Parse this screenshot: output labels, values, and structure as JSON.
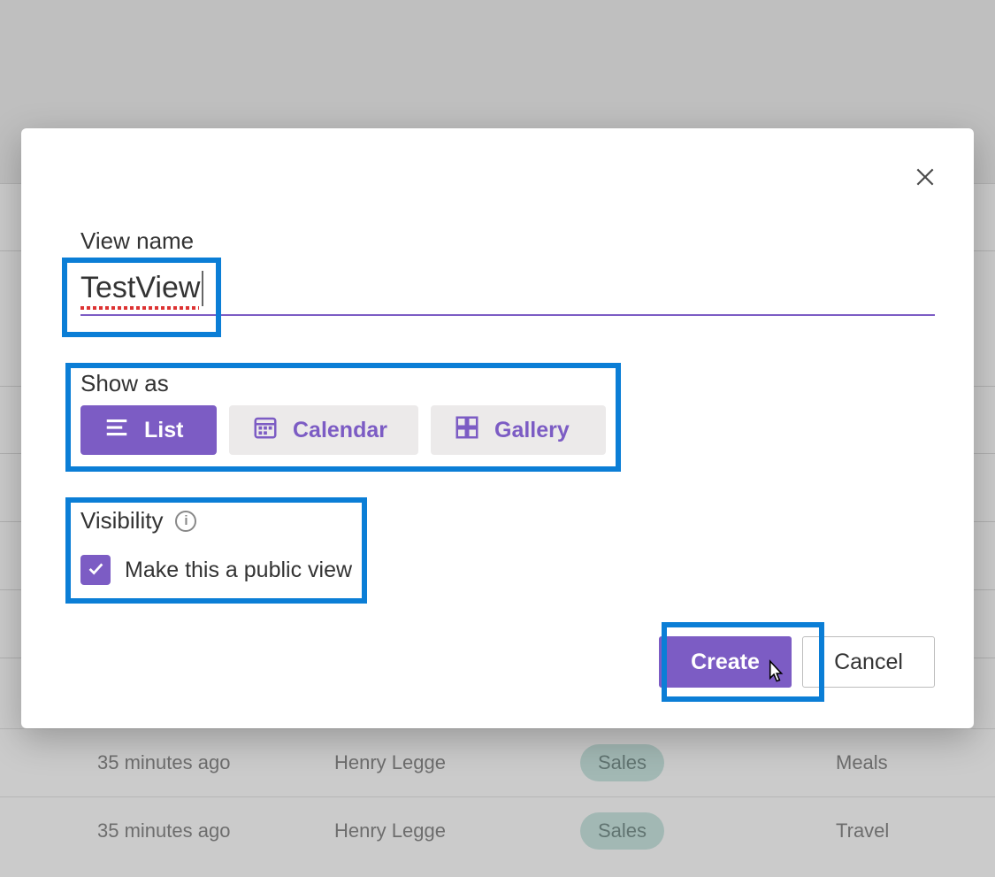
{
  "dialog": {
    "viewNameLabel": "View name",
    "viewNameValue": "TestView",
    "showAsLabel": "Show as",
    "options": {
      "list": "List",
      "calendar": "Calendar",
      "gallery": "Gallery"
    },
    "visibilityLabel": "Visibility",
    "publicCheckboxLabel": "Make this a public view",
    "publicChecked": true,
    "createLabel": "Create",
    "cancelLabel": "Cancel"
  },
  "background": {
    "rows": [
      {
        "time": "35 minutes ago",
        "name": "Henry Legge",
        "tag": "Sales",
        "category": "Meals"
      },
      {
        "time": "35 minutes ago",
        "name": "Henry Legge",
        "tag": "Sales",
        "category": "Travel"
      }
    ]
  },
  "colors": {
    "accent": "#7c5cc4",
    "annotation": "#0b7ed6",
    "pill": "#b5ddd6"
  }
}
